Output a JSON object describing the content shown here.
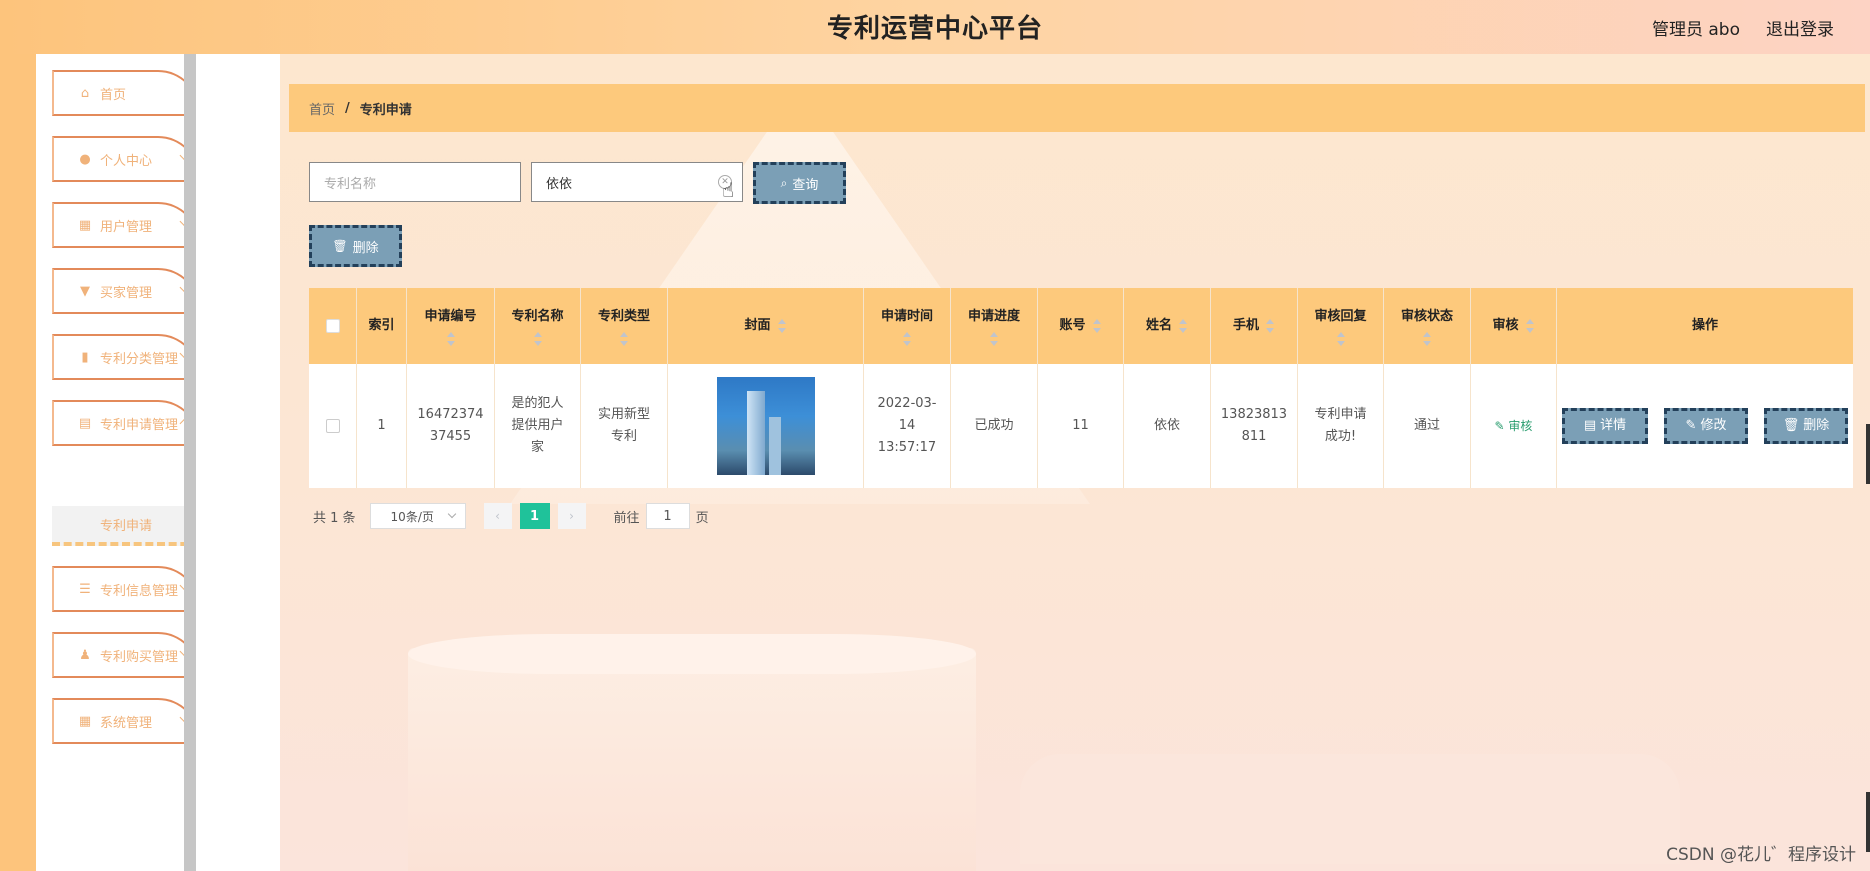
{
  "header": {
    "title": "专利运营中心平台",
    "admin": "管理员 abo",
    "logout": "退出登录"
  },
  "sidebar": {
    "items": [
      {
        "label": "首页",
        "icon": "home-icon"
      },
      {
        "label": "个人中心",
        "icon": "user-icon"
      },
      {
        "label": "用户管理",
        "icon": "grid-icon"
      },
      {
        "label": "买家管理",
        "icon": "cup-icon"
      },
      {
        "label": "专利分类管理",
        "icon": "chart-icon"
      },
      {
        "label": "专利申请管理",
        "icon": "clipboard-icon"
      },
      {
        "label": "专利信息管理",
        "icon": "sliders-icon"
      },
      {
        "label": "专利购买管理",
        "icon": "person-icon"
      },
      {
        "label": "系统管理",
        "icon": "grid-icon"
      }
    ],
    "active_sub": "专利申请"
  },
  "breadcrumb": {
    "home": "首页",
    "sep": "/",
    "current": "专利申请"
  },
  "search": {
    "name_placeholder": "专利名称",
    "second_value": "依依",
    "query_label": "查询"
  },
  "toolbar": {
    "delete_label": "删除"
  },
  "table": {
    "headers": [
      "索引",
      "申请编号",
      "专利名称",
      "专利类型",
      "封面",
      "申请时间",
      "申请进度",
      "账号",
      "姓名",
      "手机",
      "审核回复",
      "审核状态",
      "审核",
      "操作"
    ],
    "row": {
      "index": "1",
      "app_no": "16472374 37455",
      "name": "是的犯人提供用户家",
      "type": "实用新型专利",
      "time": "2022-03-14 13:57:17",
      "progress": "已成功",
      "account": "11",
      "person": "依依",
      "phone": "13823813811",
      "reply": "专利申请成功!",
      "status": "通过",
      "audit": "审核",
      "op_detail": "详情",
      "op_edit": "修改",
      "op_delete": "删除"
    }
  },
  "pager": {
    "total": "共 1 条",
    "size": "10条/页",
    "page": "1",
    "goto": "前往",
    "goto_val": "1",
    "unit": "页"
  },
  "watermark": "CSDN @花儿゛程序设计",
  "colors": {
    "accent": "#fdc97c",
    "button": "#7b9fb6",
    "pager_active": "#1fc29a"
  }
}
